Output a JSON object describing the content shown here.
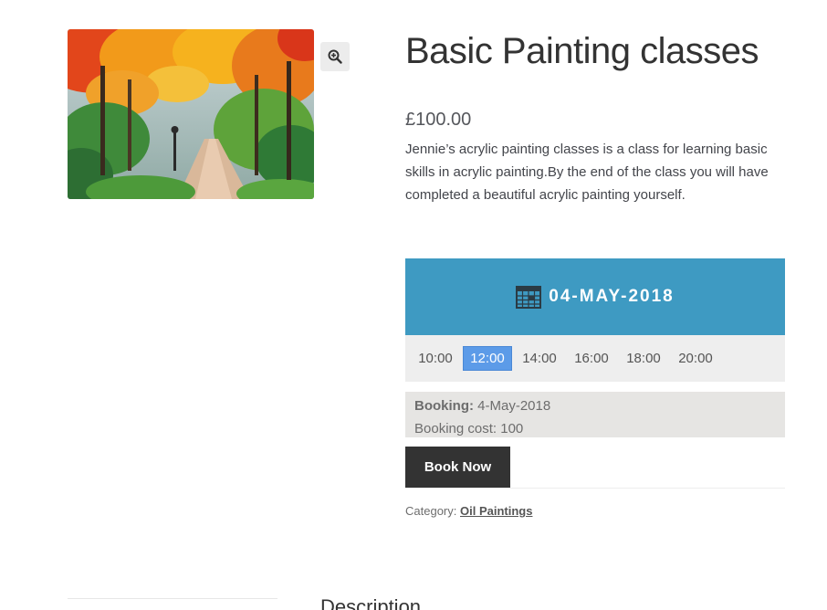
{
  "product": {
    "title": "Basic Painting classes",
    "price": "£100.00",
    "description": "Jennie’s acrylic painting classes is a class for learning basic skills in acrylic painting.By the end of the class you will have completed a beautiful acrylic painting yourself."
  },
  "gallery": {
    "zoom_icon": "zoom-in-icon"
  },
  "booking": {
    "calendar_icon": "calendar-icon",
    "date": "04-MAY-2018",
    "header_color": "#3e9ac2",
    "selected_color": "#5c9be8",
    "slots": [
      "10:00",
      "12:00",
      "14:00",
      "16:00",
      "18:00",
      "20:00"
    ],
    "selected_slot": "12:00",
    "summary": {
      "booking_label": "Booking:",
      "booking_value": "4-May-2018",
      "cost_label": "Booking cost:",
      "cost_value": "100"
    },
    "book_button": "Book Now"
  },
  "meta": {
    "category_label": "Category:",
    "category_link": "Oil Paintings"
  },
  "tabs": {
    "description": "Description"
  }
}
